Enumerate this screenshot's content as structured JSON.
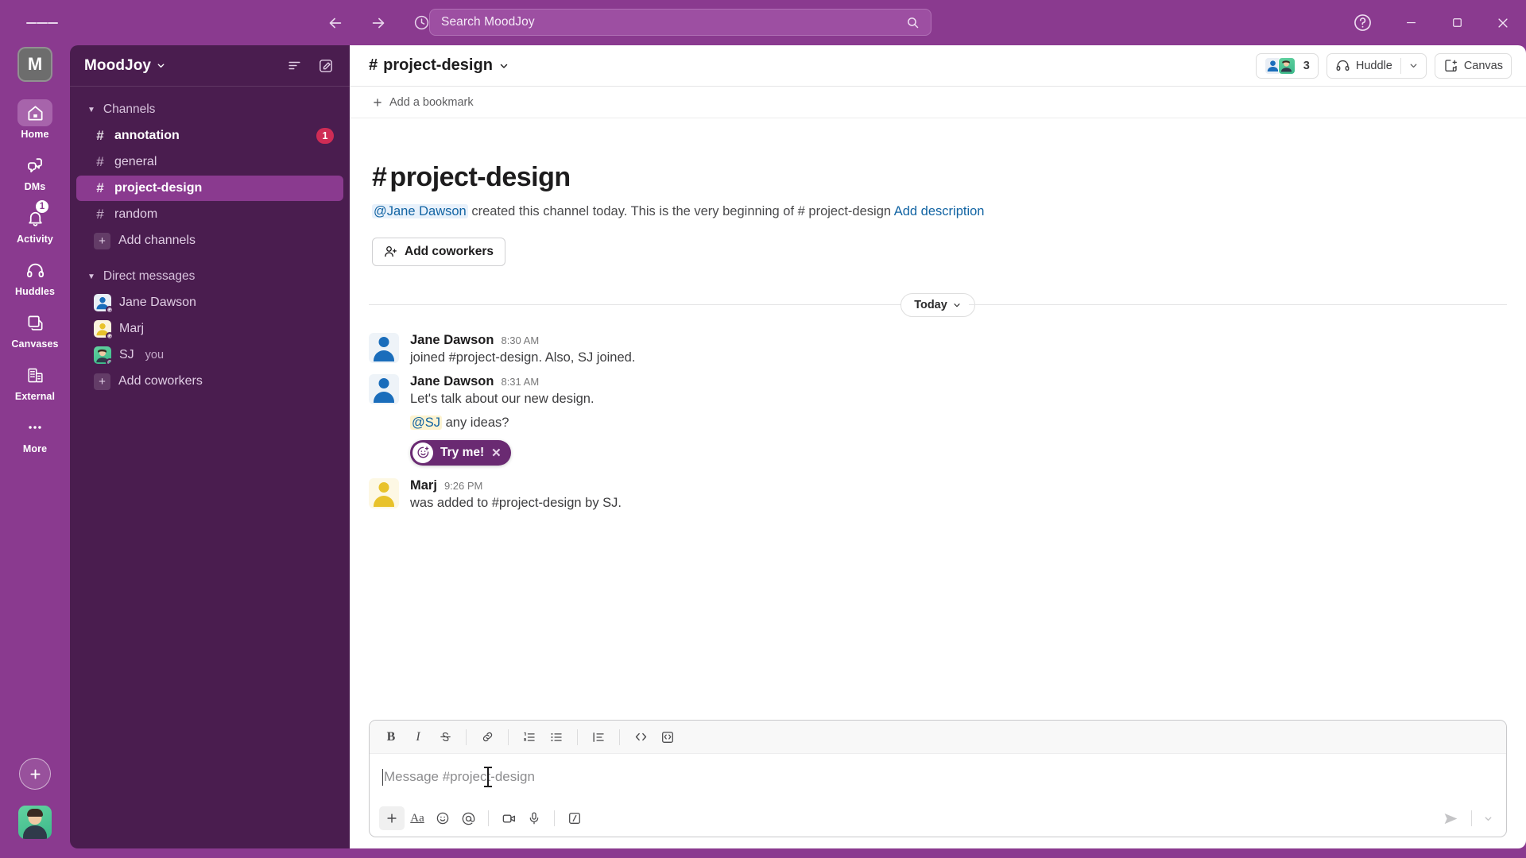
{
  "titlebar": {
    "menu_icon": "hamburger-icon",
    "back_icon": "back-arrow-icon",
    "forward_icon": "forward-arrow-icon",
    "history_icon": "clock-history-icon",
    "search_placeholder": "Search MoodJoy",
    "search_icon": "search-icon",
    "help_icon": "help-circle-icon",
    "minimize_label": "minimize",
    "maximize_label": "maximize",
    "close_label": "close"
  },
  "rail": {
    "workspace_initial": "M",
    "items": [
      {
        "label": "Home",
        "icon": "home-icon",
        "active": true,
        "badge": ""
      },
      {
        "label": "DMs",
        "icon": "dms-icon",
        "active": false,
        "badge": ""
      },
      {
        "label": "Activity",
        "icon": "bell-icon",
        "active": false,
        "badge": "1"
      },
      {
        "label": "Huddles",
        "icon": "headphones-icon",
        "active": false,
        "badge": ""
      },
      {
        "label": "Canvases",
        "icon": "canvas-icon",
        "active": false,
        "badge": ""
      },
      {
        "label": "External",
        "icon": "building-icon",
        "active": false,
        "badge": ""
      },
      {
        "label": "More",
        "icon": "more-dots-icon",
        "active": false,
        "badge": ""
      }
    ],
    "new_button_icon": "plus-icon",
    "avatar_name": "user-avatar"
  },
  "sidebar": {
    "workspace_name": "MoodJoy",
    "filter_icon": "filter-icon",
    "compose_icon": "compose-icon",
    "channels_section": "Channels",
    "channels": [
      {
        "name": "annotation",
        "unread": true,
        "badge": "1",
        "active": false
      },
      {
        "name": "general",
        "unread": false,
        "badge": "",
        "active": false
      },
      {
        "name": "project-design",
        "unread": false,
        "badge": "",
        "active": true
      },
      {
        "name": "random",
        "unread": false,
        "badge": "",
        "active": false
      }
    ],
    "add_channels": "Add channels",
    "dm_section": "Direct messages",
    "dms": [
      {
        "name": "Jane Dawson",
        "suffix": "",
        "color": "#1a6dbb"
      },
      {
        "name": "Marj",
        "suffix": "",
        "color": "#e8c22b"
      },
      {
        "name": "SJ",
        "suffix": "you",
        "color": "#3bb98a"
      }
    ],
    "add_coworkers": "Add coworkers"
  },
  "channel_header": {
    "hash": "#",
    "name": "project-design",
    "chevron_icon": "chevron-down-icon",
    "members_count": "3",
    "huddle_label": "Huddle",
    "huddle_icon": "headphones-icon",
    "huddle_caret_icon": "chevron-down-icon",
    "canvas_label": "Canvas",
    "canvas_icon": "canvas-plus-icon"
  },
  "bookmark_bar": {
    "add_label": "Add a bookmark",
    "plus_icon": "plus-icon"
  },
  "intro": {
    "hash": "#",
    "title": "project-design",
    "creator": "@Jane Dawson",
    "created_text": "created this channel today. This is the very beginning of",
    "channel_ref": "# project-design",
    "add_description": "Add description",
    "add_coworkers_label": "Add coworkers",
    "add_coworkers_icon": "person-plus-icon"
  },
  "day_divider": {
    "label": "Today",
    "caret_icon": "chevron-down-icon"
  },
  "messages": [
    {
      "author": "Jane Dawson",
      "time": "8:30 AM",
      "text": "joined #project-design. Also, SJ joined.",
      "avatar_color": "#1a6dbb",
      "avatar_bg": "#eef3f8"
    },
    {
      "author": "Jane Dawson",
      "time": "8:31 AM",
      "text": "Let's talk about our new design.",
      "avatar_color": "#1a6dbb",
      "avatar_bg": "#eef3f8",
      "sub_mention": "@SJ",
      "sub_text": "any ideas?",
      "badge": {
        "label": "Try me!",
        "emoji_icon": "add-reaction-icon",
        "close_icon": "close-icon"
      }
    },
    {
      "author": "Marj",
      "time": "9:26 PM",
      "text": "was added to #project-design by SJ.",
      "avatar_color": "#e8c22b",
      "avatar_bg": "#fdf8e4"
    }
  ],
  "composer": {
    "placeholder": "Message #project-design",
    "format_buttons": [
      {
        "name": "bold-button",
        "glyph": "B"
      },
      {
        "name": "italic-button",
        "glyph": "I"
      },
      {
        "name": "strikethrough-button",
        "glyph": "S"
      },
      {
        "name": "link-button",
        "glyph": "link"
      },
      {
        "name": "ordered-list-button",
        "glyph": "ol"
      },
      {
        "name": "bulleted-list-button",
        "glyph": "ul"
      },
      {
        "name": "blockquote-button",
        "glyph": "quote"
      },
      {
        "name": "code-button",
        "glyph": "</>"
      },
      {
        "name": "code-block-button",
        "glyph": "codeblock"
      }
    ],
    "action_buttons": [
      {
        "name": "attach-button",
        "glyph": "+"
      },
      {
        "name": "formatting-button",
        "glyph": "Aa"
      },
      {
        "name": "emoji-button",
        "glyph": "emoji"
      },
      {
        "name": "mention-button",
        "glyph": "@"
      },
      {
        "name": "video-clip-button",
        "glyph": "video"
      },
      {
        "name": "audio-clip-button",
        "glyph": "mic"
      },
      {
        "name": "slash-command-button",
        "glyph": "slash"
      }
    ],
    "send_icon": "send-icon",
    "send_caret_icon": "chevron-down-icon"
  },
  "colors": {
    "brand_purple": "#8a3a8f",
    "sidebar_purple": "#4a1d4f",
    "active_channel": "#8a3a8f",
    "badge_red": "#cf2c55",
    "link_blue": "#1264a3",
    "try_badge": "#6a2a72"
  }
}
